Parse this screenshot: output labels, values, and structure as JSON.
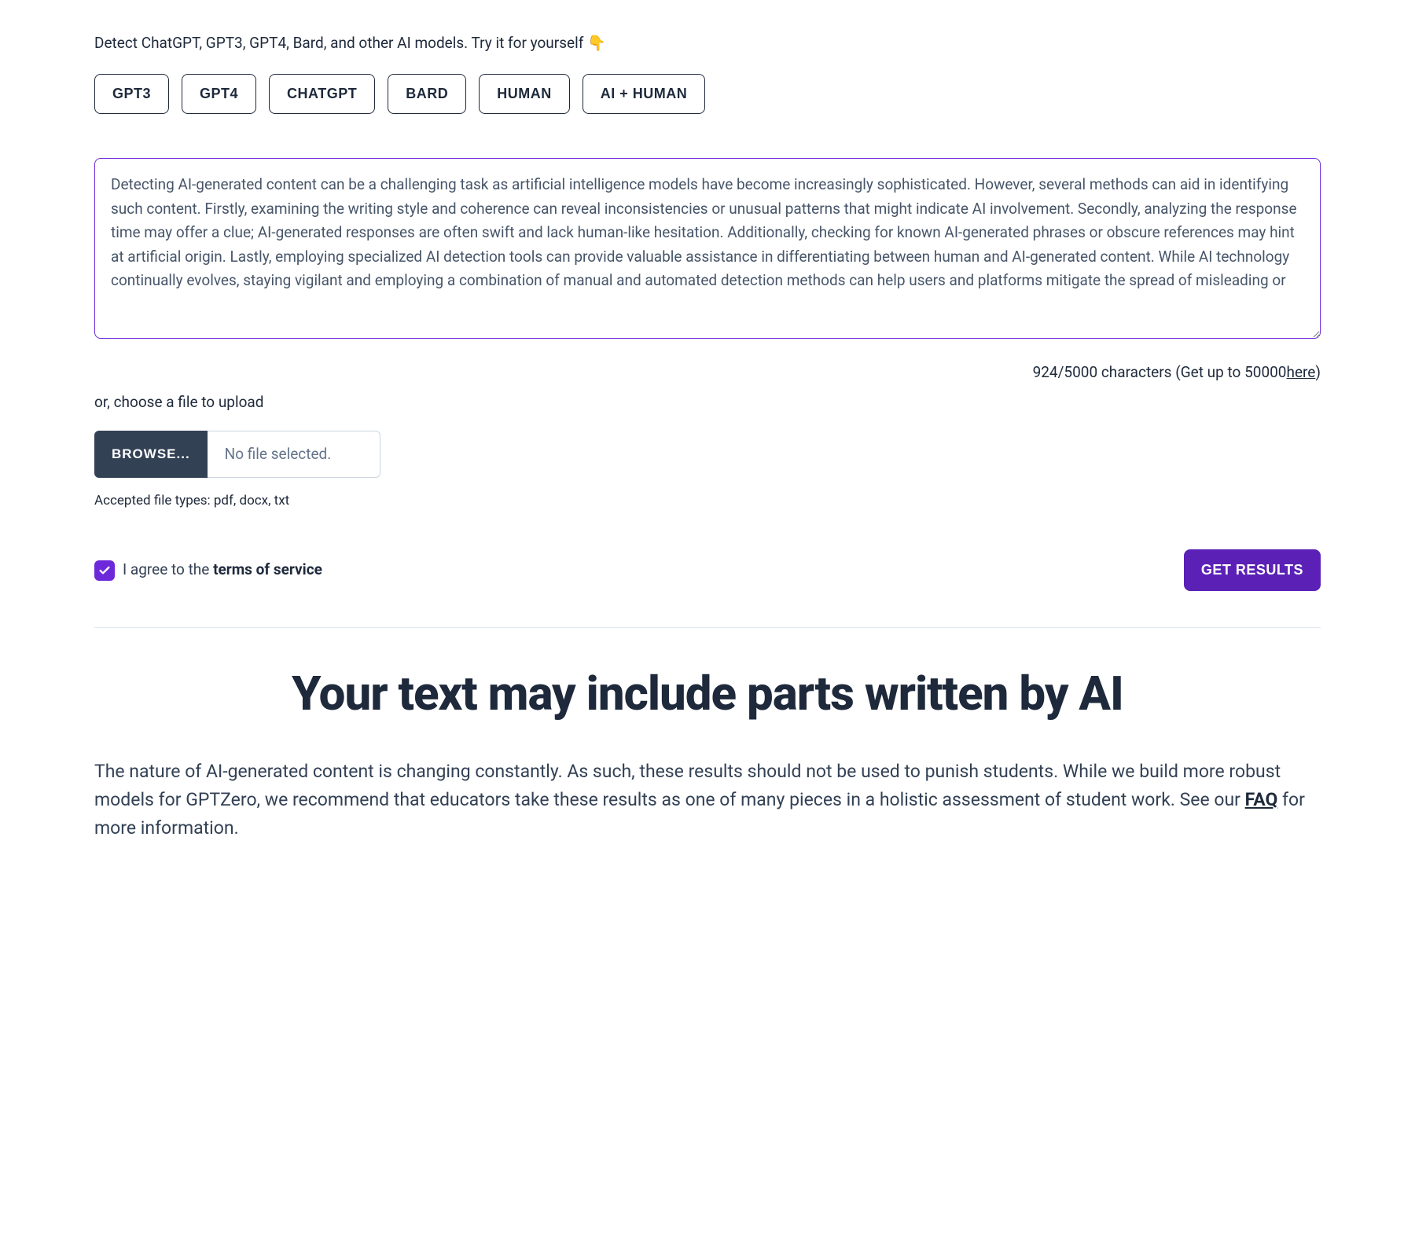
{
  "subtitle": "Detect ChatGPT, GPT3, GPT4, Bard, and other AI models. Try it for yourself 👇",
  "chips": [
    "GPT3",
    "GPT4",
    "CHATGPT",
    "BARD",
    "HUMAN",
    "AI + HUMAN"
  ],
  "textarea_value": "Detecting AI-generated content can be a challenging task as artificial intelligence models have become increasingly sophisticated. However, several methods can aid in identifying such content. Firstly, examining the writing style and coherence can reveal inconsistencies or unusual patterns that might indicate AI involvement. Secondly, analyzing the response time may offer a clue; AI-generated responses are often swift and lack human-like hesitation. Additionally, checking for known AI-generated phrases or obscure references may hint at artificial origin. Lastly, employing specialized AI detection tools can provide valuable assistance in differentiating between human and AI-generated content. While AI technology continually evolves, staying vigilant and employing a combination of manual and automated detection methods can help users and platforms mitigate the spread of misleading or",
  "char_counter": {
    "current": 924,
    "max": 5000,
    "upgrade_max": 50000,
    "prefix": "924/5000 characters (Get up to 50000 ",
    "link": "here",
    "suffix": ")"
  },
  "upload": {
    "label": "or, choose a file to upload",
    "browse": "BROWSE...",
    "file_status": "No file selected.",
    "accepted": "Accepted file types: pdf, docx, txt"
  },
  "tos": {
    "checked": true,
    "prefix": "I agree to the ",
    "link": "terms of service"
  },
  "get_results": "GET RESULTS",
  "result": {
    "heading": "Your text may include parts written by AI",
    "body_pre": "The nature of AI-generated content is changing constantly. As such, these results should not be used to punish students. While we build more robust models for GPTZero, we recommend that educators take these results as one of many pieces in a holistic assessment of student work. See our ",
    "faq": "FAQ",
    "body_post": " for more information."
  }
}
